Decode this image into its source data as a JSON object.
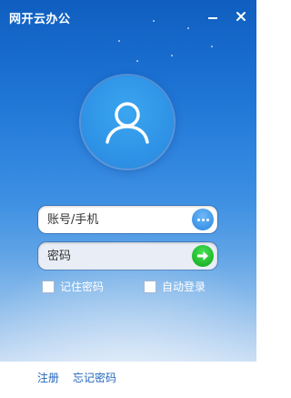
{
  "window": {
    "title": "网开云办公",
    "minimize_icon": "minimize-icon",
    "close_icon": "close-icon"
  },
  "avatar": {
    "icon": "user-icon"
  },
  "login": {
    "account_placeholder": "账号/手机",
    "password_placeholder": "密码",
    "more_icon": "more-dots-icon",
    "submit_icon": "arrow-right-icon",
    "remember_label": "记住密码",
    "auto_login_label": "自动登录"
  },
  "footer": {
    "register_label": "注册",
    "forgot_label": "忘记密码"
  },
  "colors": {
    "sky_top": "#0f5ec0",
    "sky_bottom": "#c6dcf4",
    "avatar_fill": "#2f93e6",
    "submit_green": "#22bb2d",
    "link_blue": "#2266bb"
  }
}
